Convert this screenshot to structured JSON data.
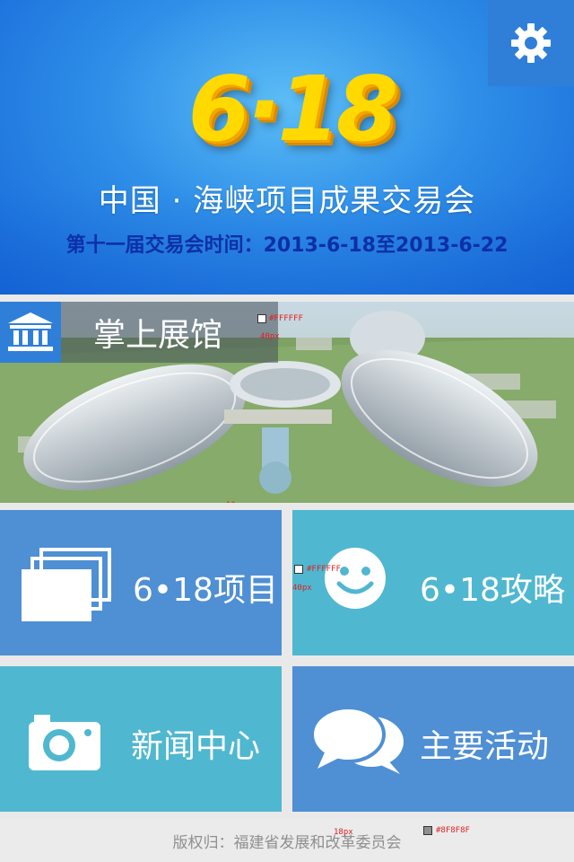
{
  "header": {
    "logo_text": "6·18",
    "title": "中国 · 海峡项目成果交易会",
    "subtitle": "第十一届交易会时间：2013-6-18至2013-6-22",
    "settings_icon": "gear-icon"
  },
  "pavilion": {
    "label": "掌上展馆",
    "icon": "museum-icon"
  },
  "tiles": [
    {
      "label": "6•18项目",
      "icon": "cards-stack-icon"
    },
    {
      "label": "6•18攻略",
      "icon": "smiley-icon"
    },
    {
      "label": "新闻中心",
      "icon": "camera-icon"
    },
    {
      "label": "主要活动",
      "icon": "chat-bubbles-icon"
    }
  ],
  "footer": {
    "copyright": "版权归：福建省发展和改革委员会"
  },
  "annotations": {
    "pav_top": "10",
    "pav_color": "#FFFFFF",
    "pav_size": "40px",
    "pav_bottom": "10",
    "tile_color": "#FFFFFF",
    "tile_size": "40px",
    "footer_size": "18px",
    "footer_color": "#8F8F8F"
  },
  "colors": {
    "accent_blue": "#2f7fd9",
    "tile_blue": "#4f8fd4",
    "tile_teal": "#50b7d0",
    "subtitle_navy": "#0d2fa8",
    "logo_yellow": "#ffd900"
  }
}
